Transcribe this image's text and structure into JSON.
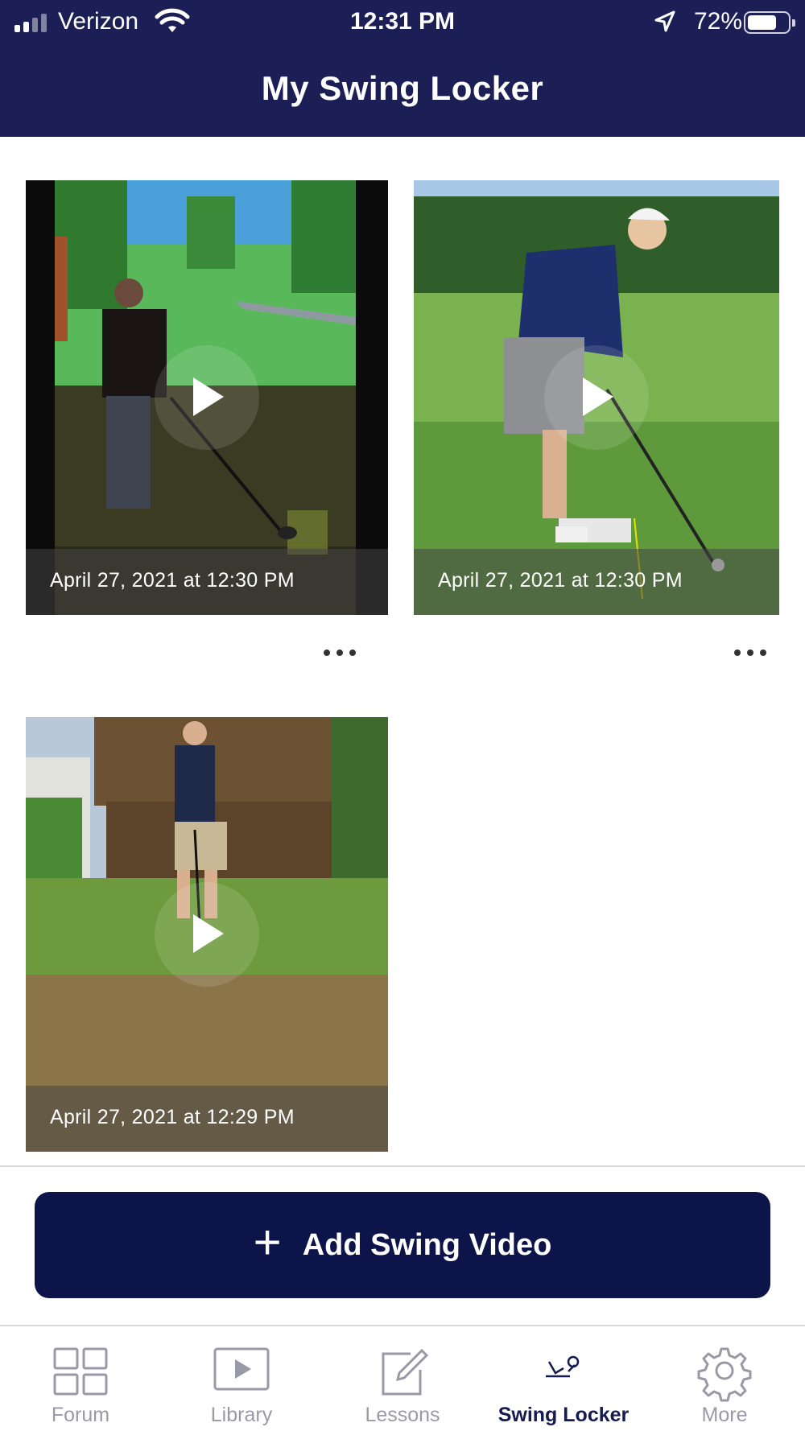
{
  "status_bar": {
    "carrier": "Verizon",
    "time": "12:31 PM",
    "battery_percent": "72%",
    "battery_level": 0.72,
    "signal_bars": 2,
    "icons": [
      "signal-icon",
      "wifi-icon",
      "location-arrow-icon",
      "battery-icon"
    ]
  },
  "header": {
    "title": "My Swing Locker"
  },
  "videos": [
    {
      "date": "April 27, 2021 at 12:30 PM",
      "scene": "indoor-simulator",
      "more_icon": "more-dots-icon"
    },
    {
      "date": "April 27, 2021 at 12:30 PM",
      "scene": "driving-range",
      "more_icon": "more-dots-icon"
    },
    {
      "date": "April 27, 2021 at 12:29 PM",
      "scene": "backyard",
      "more_icon": "more-dots-icon"
    }
  ],
  "actions": {
    "add_video_label": "Add Swing Video",
    "add_video_icon": "plus-icon"
  },
  "tab_bar": {
    "tabs": [
      {
        "label": "Forum",
        "icon": "grid-icon",
        "active": false
      },
      {
        "label": "Library",
        "icon": "play-box-icon",
        "active": false
      },
      {
        "label": "Lessons",
        "icon": "edit-icon",
        "active": false
      },
      {
        "label": "Swing Locker",
        "icon": "golf-swing-icon",
        "active": true
      },
      {
        "label": "More",
        "icon": "gear-icon",
        "active": false
      }
    ]
  },
  "colors": {
    "header_bg": "#1b1f55",
    "button_bg": "#0c1449",
    "tab_active": "#141a52",
    "tab_inactive": "#9a9aa6"
  }
}
